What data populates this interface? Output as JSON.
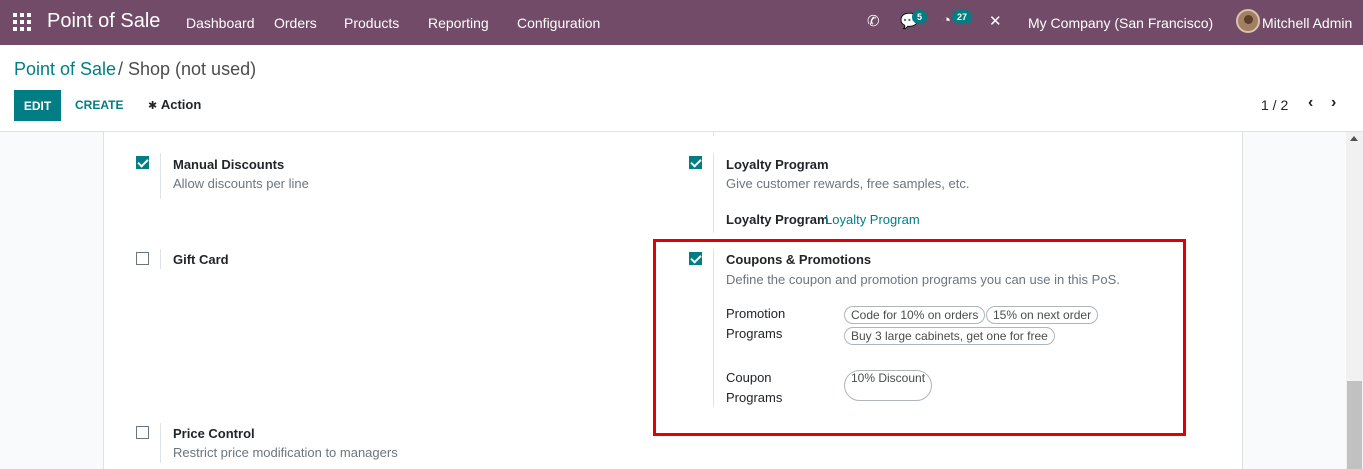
{
  "navbar": {
    "brand": "Point of Sale",
    "menu": [
      "Dashboard",
      "Orders",
      "Products",
      "Reporting",
      "Configuration"
    ],
    "messages_count": "5",
    "activities_count": "27",
    "company": "My Company (San Francisco)",
    "user": "Mitchell Admin"
  },
  "breadcrumb": {
    "parent": "Point of Sale",
    "current": "/ Shop (not used)"
  },
  "toolbar": {
    "edit": "EDIT",
    "create": "CREATE",
    "action": "Action"
  },
  "pager": {
    "value": "1 / 2"
  },
  "settings": {
    "manual_discounts": {
      "title": "Manual Discounts",
      "desc": "Allow discounts per line",
      "checked": true
    },
    "loyalty_program": {
      "title": "Loyalty Program",
      "desc": "Give customer rewards, free samples, etc.",
      "checked": true,
      "field_label": "Loyalty Program",
      "field_value": "Loyalty Program"
    },
    "gift_card": {
      "title": "Gift Card",
      "checked": false
    },
    "coupons": {
      "title": "Coupons & Promotions",
      "desc": "Define the coupon and promotion programs you can use in this PoS.",
      "checked": true,
      "promo_label_1": "Promotion",
      "promo_label_2": "Programs",
      "promotions": [
        "Code for 10% on orders",
        "15% on next order",
        "Buy 3 large cabinets, get one for free"
      ],
      "coupon_label_1": "Coupon",
      "coupon_label_2": "Programs",
      "coupons": [
        "10% Discount"
      ]
    },
    "price_control": {
      "title": "Price Control",
      "desc": "Restrict price modification to managers",
      "checked": false
    }
  },
  "colors": {
    "navbar": "#714b67",
    "primary": "#017e84",
    "highlight": "#e40000"
  }
}
